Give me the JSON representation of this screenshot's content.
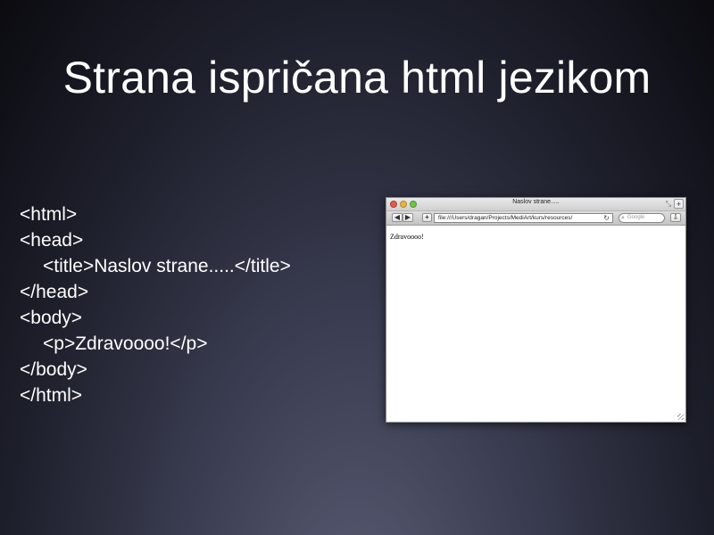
{
  "slide": {
    "title": "Strana ispričana html jezikom"
  },
  "code_lines": [
    "<html>",
    "<head>",
    "<title>Naslov strane.....</title>",
    "</head>",
    "<body>",
    "<p>Zdravoooo!</p>",
    "</body>",
    "</html>"
  ],
  "browser": {
    "window_title": "Naslov strane.....",
    "address": "file:///Users/dragan/Projects/MediArt/kurs/resources/",
    "search_placeholder": "Google",
    "content_text": "Zdravoooo!",
    "back_label": "◀",
    "forward_label": "▶",
    "add_label": "+",
    "reload_label": "↻",
    "new_tab_label": "+",
    "search_icon": "⌕",
    "bookmark_label": "⇩"
  },
  "colors": {
    "close": "#e05b50",
    "minimize": "#e8b33c",
    "maximize": "#71c446"
  }
}
